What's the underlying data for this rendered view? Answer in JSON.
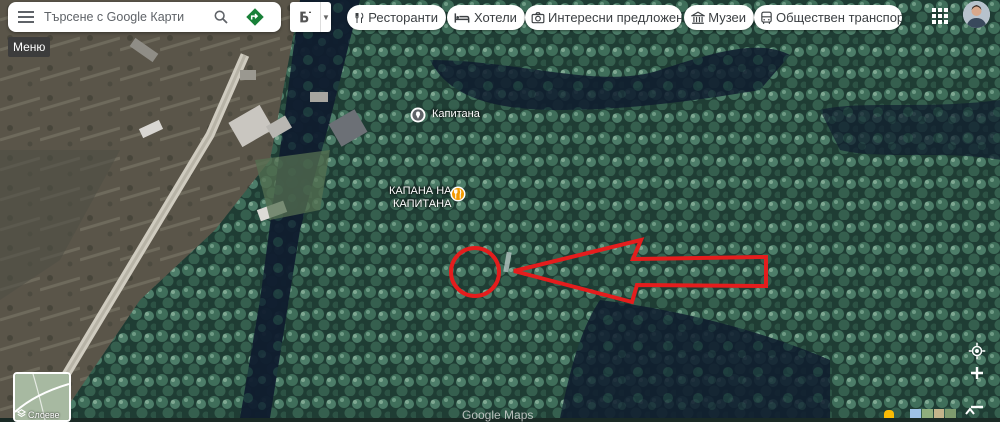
{
  "search": {
    "placeholder": "Търсене с Google Карти",
    "menu_tooltip": "Меню"
  },
  "chips": [
    {
      "icon": "fork-knife-icon",
      "label": "Ресторанти"
    },
    {
      "icon": "bed-icon",
      "label": "Хотели"
    },
    {
      "icon": "camera-icon",
      "label": "Интересни предложения"
    },
    {
      "icon": "museum-icon",
      "label": "Музеи"
    },
    {
      "icon": "bus-icon",
      "label": "Обществен транспорт"
    }
  ],
  "layer_switch_icon": "transit-layer-icon",
  "places": [
    {
      "name": "Капитана",
      "icon": "place-pin-icon"
    },
    {
      "name_line1": "КАПАНА НА",
      "name_line2": "КАПИТАНА",
      "icon": "restaurant-pin-icon"
    }
  ],
  "layers_thumb_label": "Слоеве",
  "attribution": "Google Maps",
  "colors": {
    "annotation_red": "#e41d1d",
    "directions_green": "#188038",
    "accent_blue": "#1a73e8",
    "restaurant_orange": "#f29900"
  }
}
